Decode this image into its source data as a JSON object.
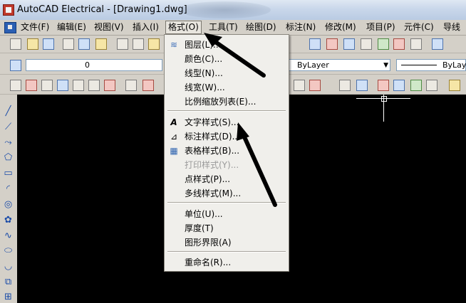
{
  "window": {
    "title": "AutoCAD Electrical - [Drawing1.dwg]"
  },
  "menubar": {
    "items": [
      {
        "label": "文件(F)"
      },
      {
        "label": "编辑(E)"
      },
      {
        "label": "视图(V)"
      },
      {
        "label": "插入(I)"
      },
      {
        "label": "格式(O)"
      },
      {
        "label": "工具(T)"
      },
      {
        "label": "绘图(D)"
      },
      {
        "label": "标注(N)"
      },
      {
        "label": "修改(M)"
      },
      {
        "label": "项目(P)"
      },
      {
        "label": "元件(C)"
      },
      {
        "label": "导线"
      }
    ]
  },
  "layer_toolbar": {
    "layer_value": "0",
    "color_value": "ByLayer",
    "linetype_value": "ByLay"
  },
  "format_menu": {
    "items": [
      {
        "label": "图层(L)...",
        "icon": "layers-icon"
      },
      {
        "label": "颜色(C)..."
      },
      {
        "label": "线型(N)..."
      },
      {
        "label": "线宽(W)..."
      },
      {
        "label": "比例缩放列表(E)..."
      },
      {
        "label": "文字样式(S)...",
        "icon": "text-style-icon"
      },
      {
        "label": "标注样式(D)...",
        "icon": "dim-style-icon"
      },
      {
        "label": "表格样式(B)...",
        "icon": "table-style-icon"
      },
      {
        "label": "打印样式(Y)...",
        "disabled": true
      },
      {
        "label": "点样式(P)..."
      },
      {
        "label": "多线样式(M)..."
      },
      {
        "label": "单位(U)..."
      },
      {
        "label": "厚度(T)"
      },
      {
        "label": "图形界限(A)"
      },
      {
        "label": "重命名(R)..."
      }
    ]
  },
  "colors": {
    "canvas": "#000000",
    "arrow": "#000000",
    "chrome": "#d4d0c8"
  }
}
